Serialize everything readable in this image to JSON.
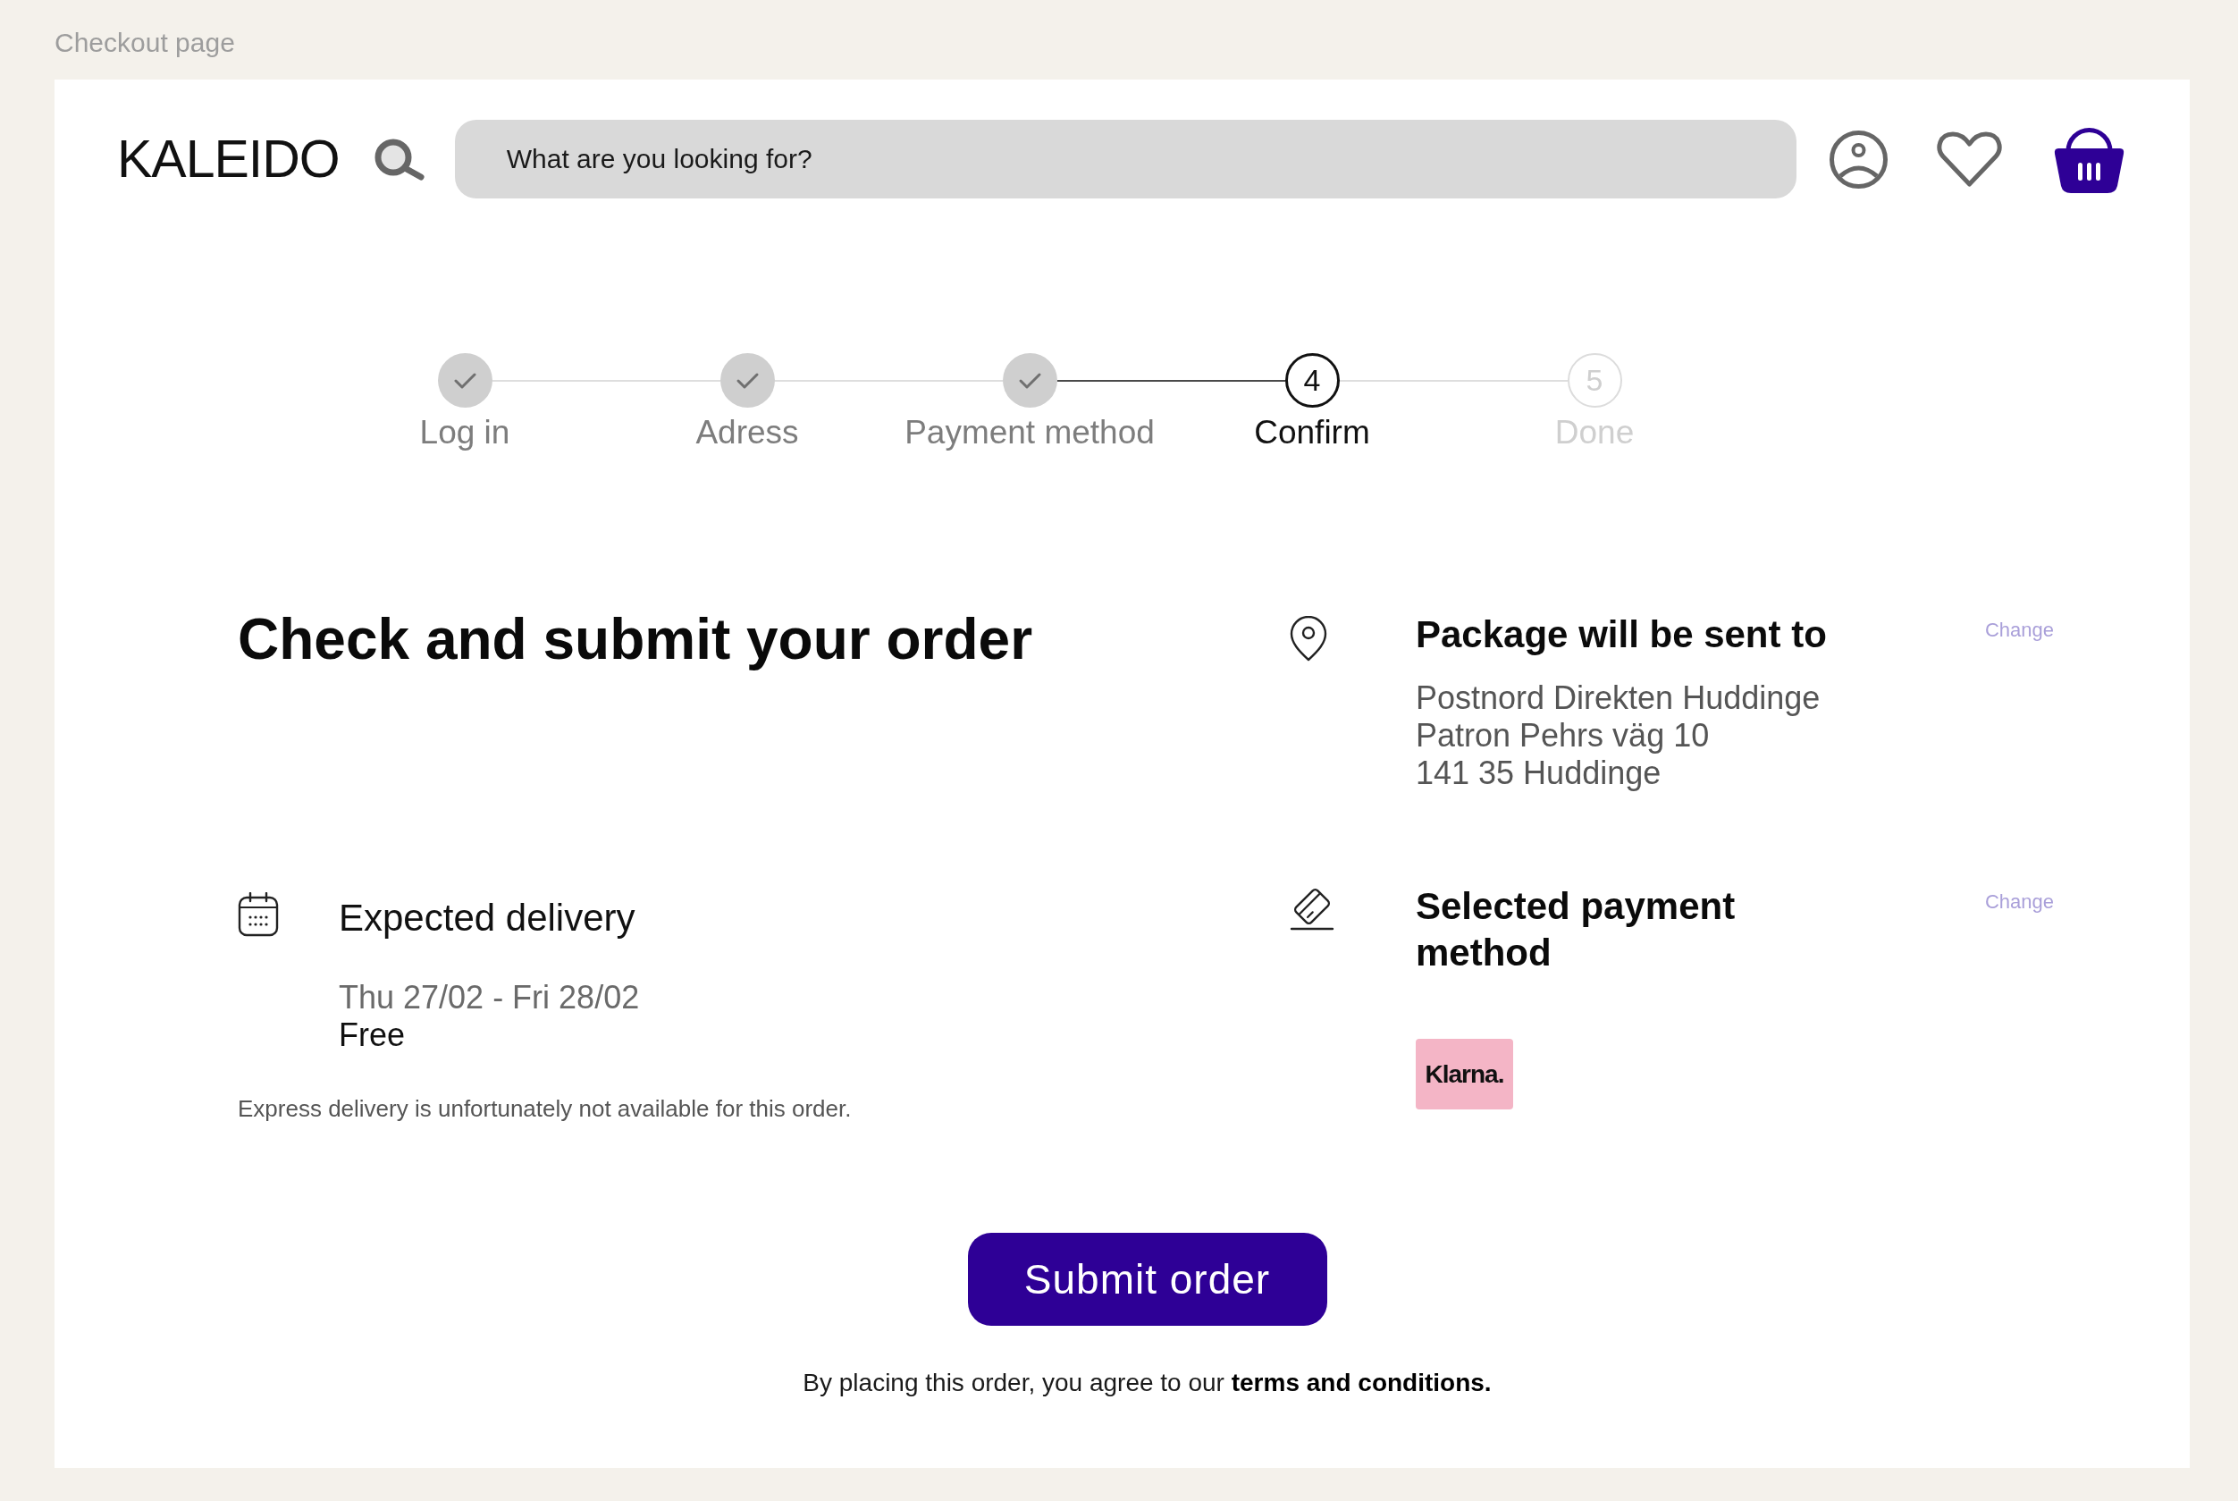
{
  "page_label": "Checkout page",
  "header": {
    "logo": "KALEIDO",
    "search": {
      "placeholder": "What are you looking for?"
    }
  },
  "steps": [
    {
      "label": "Log in",
      "kind": "done"
    },
    {
      "label": "Adress",
      "kind": "done"
    },
    {
      "label": "Payment method",
      "kind": "done"
    },
    {
      "label": "Confirm",
      "kind": "current",
      "number": "4"
    },
    {
      "label": "Done",
      "kind": "upcoming",
      "number": "5"
    }
  ],
  "order": {
    "title": "Check and submit your order",
    "shipping": {
      "title": "Package will be sent to",
      "change": "Change",
      "address": [
        "Postnord Direkten Huddinge",
        "Patron Pehrs väg 10",
        "141 35 Huddinge"
      ]
    },
    "delivery": {
      "title": "Expected delivery",
      "dates": "Thu 27/02 - Fri 28/02",
      "price": "Free",
      "note": "Express delivery is unfortunately not available for this order."
    },
    "payment": {
      "title": "Selected payment method",
      "change": "Change",
      "method": "Klarna."
    }
  },
  "submit": {
    "label": "Submit order",
    "terms": "By placing this order, you agree to our **terms and conditions.**"
  }
}
